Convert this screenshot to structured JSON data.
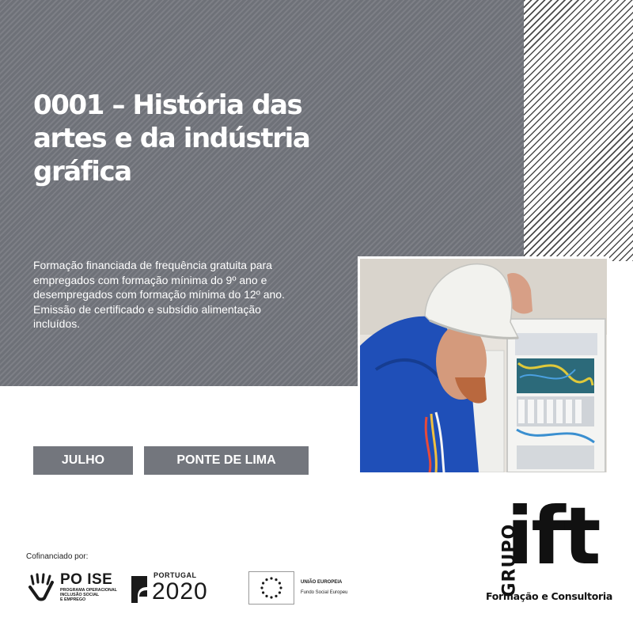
{
  "course": {
    "title": "0001 – História das artes e da indústria gráfica",
    "description": "Formação financiada de frequência gratuita para empregados com formação mínima do 9º ano e desempregados com formação mínima do 12º ano. Emissão de certificado e subsídio alimentação incluídos.",
    "month": "JULHO",
    "location": "PONTE DE LIMA"
  },
  "funding": {
    "label": "Cofinanciado por:",
    "poise": {
      "name": "PO ISE",
      "subtitle_lines": [
        "PROGRAMA OPERACIONAL",
        "INCLUSÃO SOCIAL",
        "E EMPREGO"
      ]
    },
    "portugal2020": {
      "label": "PORTUGAL",
      "year": "2020"
    },
    "eu": {
      "name": "UNIÃO EUROPEIA",
      "fund": "Fundo Social Europeu"
    }
  },
  "brand": {
    "vertical": "GRUPO",
    "name": "ift",
    "tagline": "Formação e Consultoria"
  },
  "colors": {
    "panel_grey": "#6e7178",
    "tag_grey": "#73767d",
    "text_dark": "#111111",
    "helmet_white": "#f2f2ee",
    "shirt_blue": "#1f4fb8"
  },
  "icons": {
    "poise": "hand-icon",
    "portugal2020": "portugal2020-symbol-icon",
    "eu": "eu-flag-icon"
  }
}
